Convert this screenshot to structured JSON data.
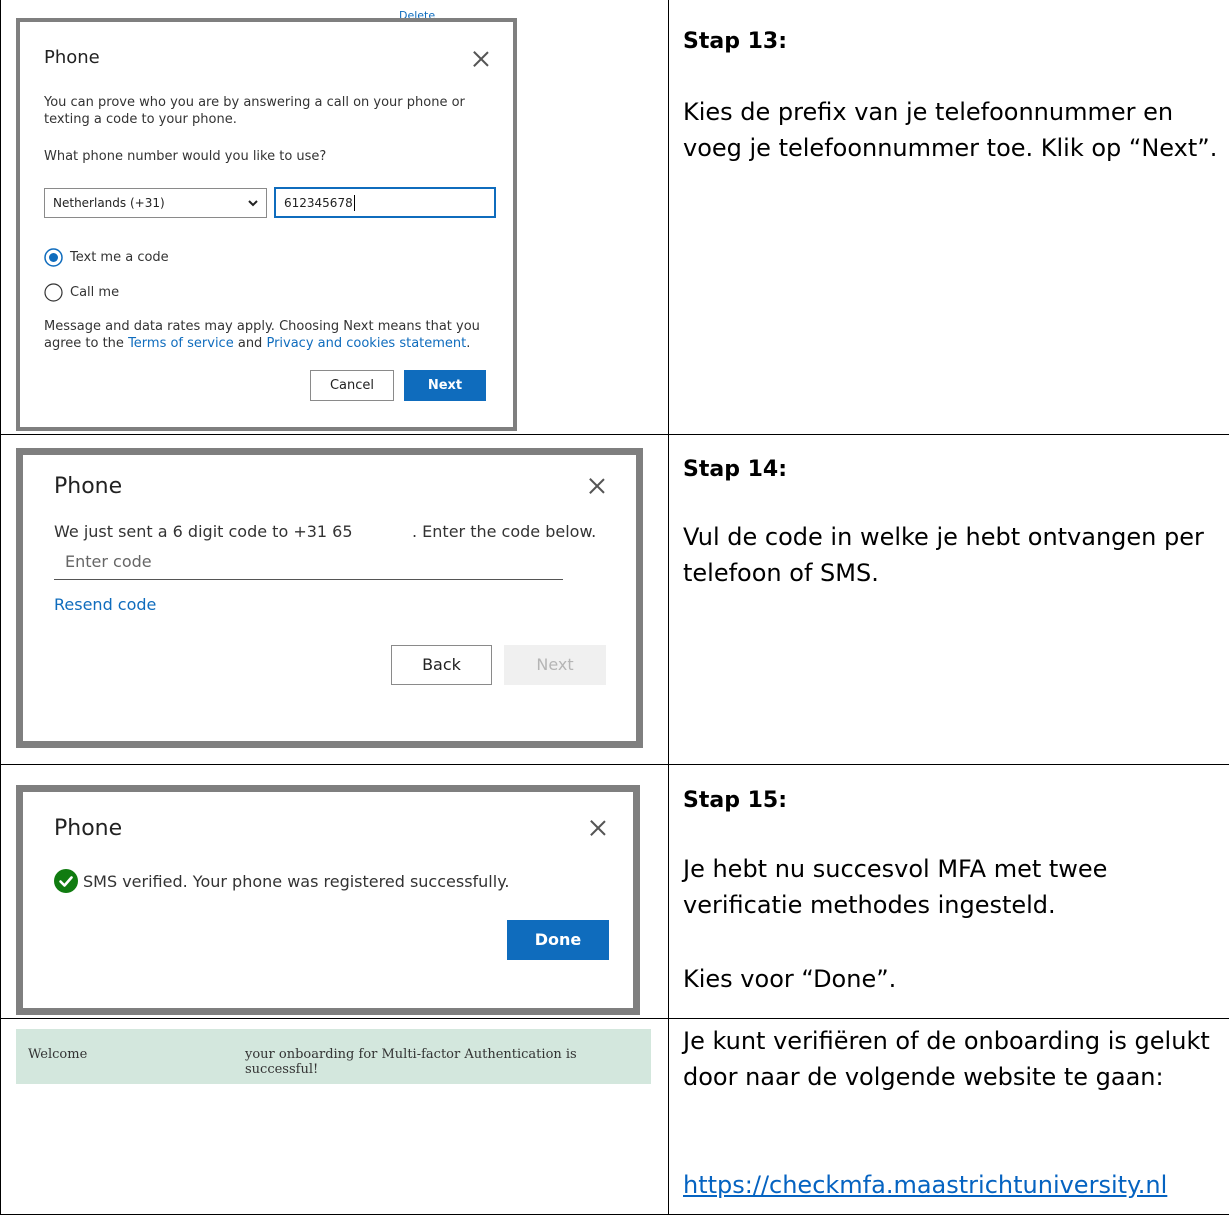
{
  "step13": {
    "partial_top": "Delete",
    "dialog": {
      "title": "Phone",
      "intro": "You can prove who you are by answering a call on your phone or texting a code to your phone.",
      "question": "What phone number would you like to use?",
      "country_value": "Netherlands (+31)",
      "phone_value": "612345678",
      "option_text": "Text me a code",
      "option_call": "Call me",
      "disclaimer_pre": "Message and data rates may apply. Choosing Next means that you agree to the ",
      "terms_link": "Terms of service",
      "and": " and ",
      "privacy_link": "Privacy and cookies statement",
      "period": ".",
      "cancel_label": "Cancel",
      "next_label": "Next"
    },
    "heading": "Stap 13:",
    "body": "Kies de prefix van je telefoonnummer en voeg je telefoonnummer toe. Klik op “Next”."
  },
  "step14": {
    "dialog": {
      "title": "Phone",
      "sent_pre": "We just sent a 6 digit code to +31 65",
      "sent_post": ". Enter the code below.",
      "code_placeholder": "Enter code",
      "resend": "Resend code",
      "back_label": "Back",
      "next_label": "Next"
    },
    "heading": "Stap 14:",
    "body": "Vul de code in welke je hebt ontvangen per telefoon of SMS."
  },
  "step15": {
    "dialog": {
      "title": "Phone",
      "verified": "SMS verified. Your phone was registered successfully.",
      "done_label": "Done"
    },
    "heading": "Stap 15:",
    "body1": "Je hebt nu succesvol MFA met twee verificatie methodes ingesteld.",
    "body2": "Kies voor “Done”."
  },
  "final": {
    "banner_welcome": "Welcome",
    "banner_message": "your onboarding for Multi-factor Authentication is successful!",
    "body": "Je kunt verifiëren of de onboarding is gelukt door naar de volgende website te gaan:",
    "link": "https://checkmfa.maastrichtuniversity.nl"
  },
  "colors": {
    "primary": "#0f6cbd",
    "banner_bg": "#d3e7dd",
    "success": "#107c10",
    "link": "#0563c1"
  }
}
